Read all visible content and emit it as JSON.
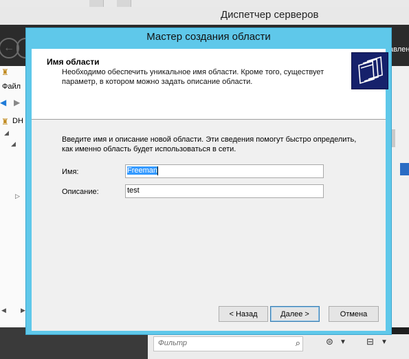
{
  "background": {
    "title": "Диспетчер серверов",
    "right_partial_text": "авлен",
    "menu_file": "Файл",
    "tree_item": "DH",
    "filter_placeholder": "Фильтр"
  },
  "wizard": {
    "title": "Мастер создания области",
    "header_title": "Имя области",
    "header_desc": "Необходимо обеспечить уникальное имя области. Кроме того, существует параметр, в котором можно задать описание области.",
    "intro": "Введите имя и описание новой области. Эти сведения помогут быстро определить, как именно область будет использоваться в сети.",
    "name_label": "Имя:",
    "name_value": "Freeman",
    "desc_label": "Описание:",
    "desc_value": "test",
    "buttons": {
      "back": "< Назад",
      "next": "Далее >",
      "cancel": "Отмена"
    }
  },
  "colors": {
    "dialog_frame": "#5fc8ea",
    "header_icon_bg": "#16216b",
    "selection": "#3399ff"
  }
}
